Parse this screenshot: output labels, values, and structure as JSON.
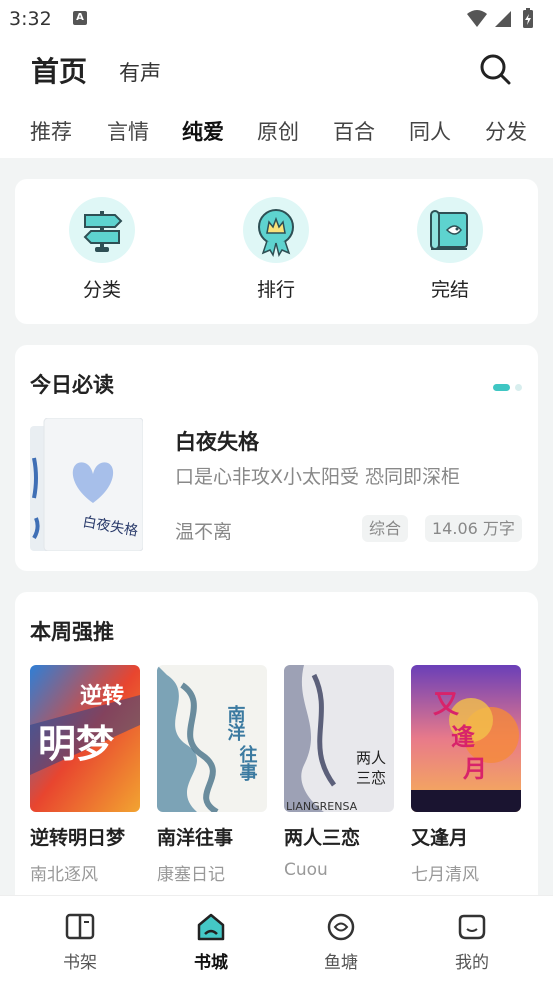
{
  "status_bar": {
    "time": "3:32",
    "notif_icon": "A"
  },
  "header": {
    "title": "首页",
    "audio_tab": "有声",
    "tabs": [
      "推荐",
      "言情",
      "纯爱",
      "原创",
      "百合",
      "同人",
      "分发"
    ],
    "active_tab": "纯爱"
  },
  "quick_links": [
    {
      "label": "分类",
      "icon": "signpost-icon"
    },
    {
      "label": "排行",
      "icon": "ranking-badge-icon"
    },
    {
      "label": "完结",
      "icon": "completed-scroll-icon"
    }
  ],
  "today": {
    "section_title": "今日必读",
    "book": {
      "title": "白夜失格",
      "description": "口是心非攻X小太阳受  恐同即深柜",
      "author": "温不离",
      "tags": [
        "综合",
        "14.06 万字"
      ]
    }
  },
  "weekly": {
    "section_title": "本周强推",
    "books": [
      {
        "title": "逆转明日梦",
        "author": "南北逐风"
      },
      {
        "title": "南洋往事",
        "author": "康塞日记"
      },
      {
        "title": "两人三恋",
        "author": "Cuou"
      },
      {
        "title": "又逢月",
        "author": "七月清风"
      }
    ]
  },
  "bottom_nav": [
    {
      "label": "书架",
      "icon": "bookshelf-icon"
    },
    {
      "label": "书城",
      "icon": "bookstore-icon"
    },
    {
      "label": "鱼塘",
      "icon": "fishpond-icon"
    },
    {
      "label": "我的",
      "icon": "profile-icon"
    }
  ],
  "active_nav": "书城",
  "colors": {
    "accent": "#44c8c6",
    "background": "#f2f4f4"
  }
}
